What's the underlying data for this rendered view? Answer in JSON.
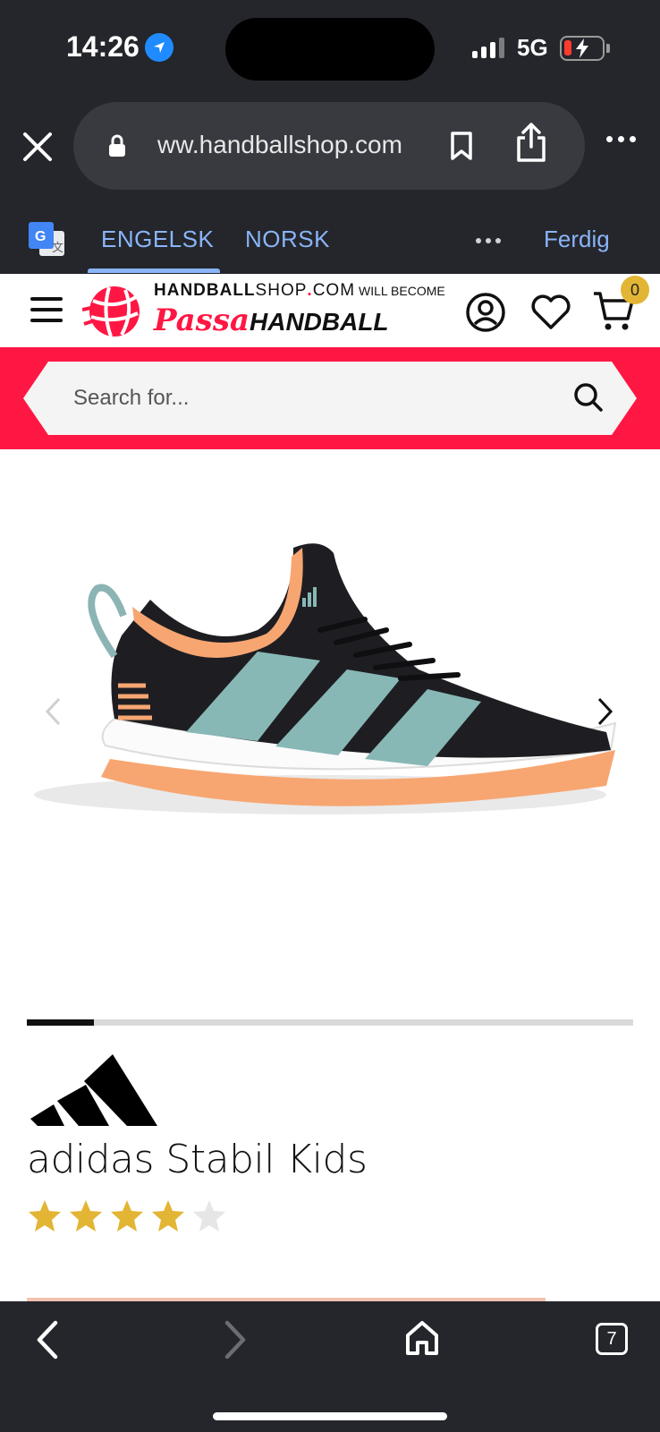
{
  "status": {
    "time": "14:26",
    "network": "5G",
    "battery_color": "#ff3b30"
  },
  "browser": {
    "url": "ww.handballshop.com",
    "translate": {
      "tab_source": "ENGELSK",
      "tab_target": "NORSK",
      "done": "Ferdig"
    },
    "tabs_count": "7"
  },
  "site": {
    "logo_top": "HANDBALL",
    "logo_top_thin": "SHOP",
    "logo_dot": ".",
    "logo_com": "COM",
    "logo_will": "WILL BECOME",
    "logo_passa": "Passa",
    "logo_handball": "HANDBALL",
    "cart_count": "0",
    "accent": "#ff1744",
    "badge_color": "#e2b534"
  },
  "search": {
    "placeholder": "Search for..."
  },
  "product": {
    "brand_icon": "adidas-logo",
    "title": "adidas Stabil Kids",
    "rating": 4,
    "rating_max": 5,
    "image_icon": "shoe-image",
    "gallery_progress": 0.11
  },
  "nav": {
    "back_icon": "chevron-left-icon",
    "forward_icon": "chevron-right-icon",
    "home_icon": "home-icon"
  }
}
